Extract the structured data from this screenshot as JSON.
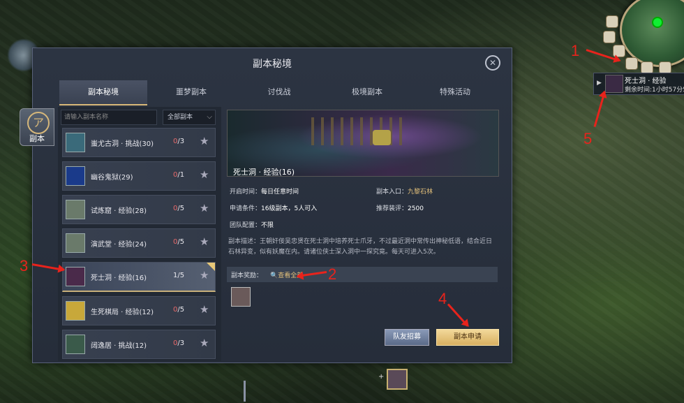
{
  "panel": {
    "title": "副本秘境",
    "close_icon": "close-circle-icon"
  },
  "side_tab": {
    "glyph": "ア",
    "label": "副本"
  },
  "tabs": [
    "副本秘境",
    "噩梦副本",
    "讨伐战",
    "极境副本",
    "特殊活动"
  ],
  "active_tab": 0,
  "search": {
    "placeholder": "请输入副本名称"
  },
  "filter": {
    "value": "全部副本"
  },
  "instances": [
    {
      "name": "蚩尤古洞 · 挑战(30)",
      "used": "0",
      "total": "/3",
      "thumb_color": "#3a6a7a"
    },
    {
      "name": "幽谷鬼狱(29)",
      "used": "0",
      "total": "/1",
      "thumb_color": "#1a3a8a"
    },
    {
      "name": "试炼窟 · 经验(28)",
      "used": "0",
      "total": "/5",
      "thumb_color": "#6a7a6a"
    },
    {
      "name": "演武堂 · 经验(24)",
      "used": "0",
      "total": "/5",
      "thumb_color": "#6a7a6a"
    },
    {
      "name": "死士洞 · 经验(16)",
      "used": "1",
      "total": "/5",
      "thumb_color": "#4a2a4a",
      "selected": true
    },
    {
      "name": "生死棋局 · 经验(12)",
      "used": "0",
      "total": "/5",
      "thumb_color": "#c8a83a"
    },
    {
      "name": "阔逸居 · 挑战(12)",
      "used": "0",
      "total": "/3",
      "thumb_color": "#3a5a4a"
    }
  ],
  "detail": {
    "banner_title": "死士洞 · 经验(16)",
    "open_time_label": "开启时间：",
    "open_time": "每日任意时间",
    "entrance_label": "副本入口：",
    "entrance": "九黎石林",
    "apply_cond_label": "申请条件：",
    "apply_cond": "16级副本，5人可入",
    "rec_gear_label": "推荐装评：",
    "rec_gear": "2500",
    "team_label": "团队配置：",
    "team": "不限",
    "desc_label": "副本描述：",
    "desc": "王朝奸佞吴忠贤在死士洞中培养死士爪牙，不过最近洞中常传出神秘低语，结合近日石林异变，似有妖魔在内。请诸位侠士深入洞中一探究竟。每天可进入5次。",
    "reward_label": "副本奖励：",
    "reward_link": "查看全部",
    "reward_icon": "magnifier-icon"
  },
  "buttons": {
    "recruit": "队友招募",
    "apply": "副本申请"
  },
  "quest_tracker": {
    "title": "死士洞 · 经验",
    "time": "剩余时间:1小时57分5"
  },
  "annotations": [
    "1",
    "2",
    "3",
    "4",
    "5"
  ],
  "colors": {
    "accent_gold": "#e3c07a",
    "annotation_red": "#e8231c"
  }
}
